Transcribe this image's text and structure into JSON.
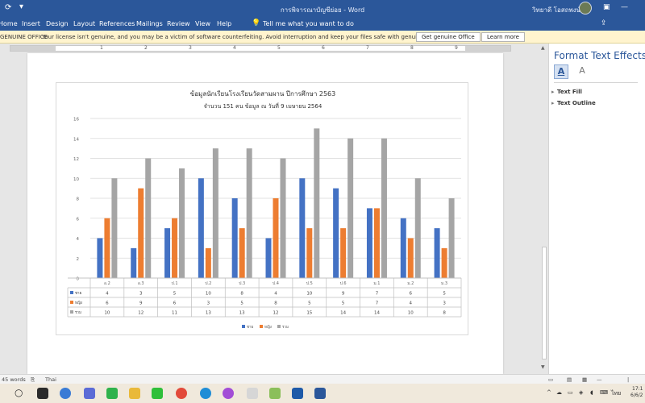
{
  "titlebar": {
    "doc_title": "การพิจารณาบัญชีย่อย  -  Word",
    "user_name": "วิทยาดี โอสถพงษ์ญ"
  },
  "ribbon_tabs": [
    "Home",
    "Insert",
    "Design",
    "Layout",
    "References",
    "Mailings",
    "Review",
    "View",
    "Help"
  ],
  "tell_me": "Tell me what you want to do",
  "message_bar": {
    "title": "GENUINE OFFICE",
    "text": "Your license isn't genuine, and you may be a victim of software counterfeiting. Avoid interruption and keep your files safe with genuine Office today.",
    "btn_get": "Get genuine Office",
    "btn_learn": "Learn more"
  },
  "ruler_numbers": [
    "1",
    "2",
    "3",
    "4",
    "5",
    "6",
    "7",
    "8",
    "9"
  ],
  "format_pane": {
    "title": "Format Text Effects",
    "text_fill": "Text Fill",
    "text_outline": "Text Outline"
  },
  "status": {
    "words": "45 words",
    "lang": "Thai"
  },
  "taskbar": {
    "time": "17:1",
    "date": "6/6/2",
    "lang": "ไทย"
  },
  "chart_data": {
    "type": "bar",
    "title": "ข้อมูลนักเรียนโรงเรียนวัดสามผาน ปีการศึกษา 2563",
    "subtitle": "จำนวน 151 คน ข้อมูล ณ วันที่ 9 เมษายน 2564",
    "categories": [
      "อ.2",
      "อ.3",
      "ป.1",
      "ป.2",
      "ป.3",
      "ป.4",
      "ป.5",
      "ป.6",
      "ม.1",
      "ม.2",
      "ม.3"
    ],
    "series": [
      {
        "name": "ชาย",
        "color": "#4472c4",
        "values": [
          4,
          3,
          5,
          10,
          8,
          4,
          10,
          9,
          7,
          6,
          5
        ]
      },
      {
        "name": "หญิง",
        "color": "#ed7d31",
        "values": [
          6,
          9,
          6,
          3,
          5,
          8,
          5,
          5,
          7,
          4,
          3
        ]
      },
      {
        "name": "รวม",
        "color": "#a5a5a5",
        "values": [
          10,
          12,
          11,
          13,
          13,
          12,
          15,
          14,
          14,
          10,
          8
        ]
      }
    ],
    "ylim": [
      0,
      16
    ],
    "yticks": [
      0,
      2,
      4,
      6,
      8,
      10,
      12,
      14,
      16
    ],
    "grid": true,
    "data_table": true,
    "legend": "bottom"
  }
}
